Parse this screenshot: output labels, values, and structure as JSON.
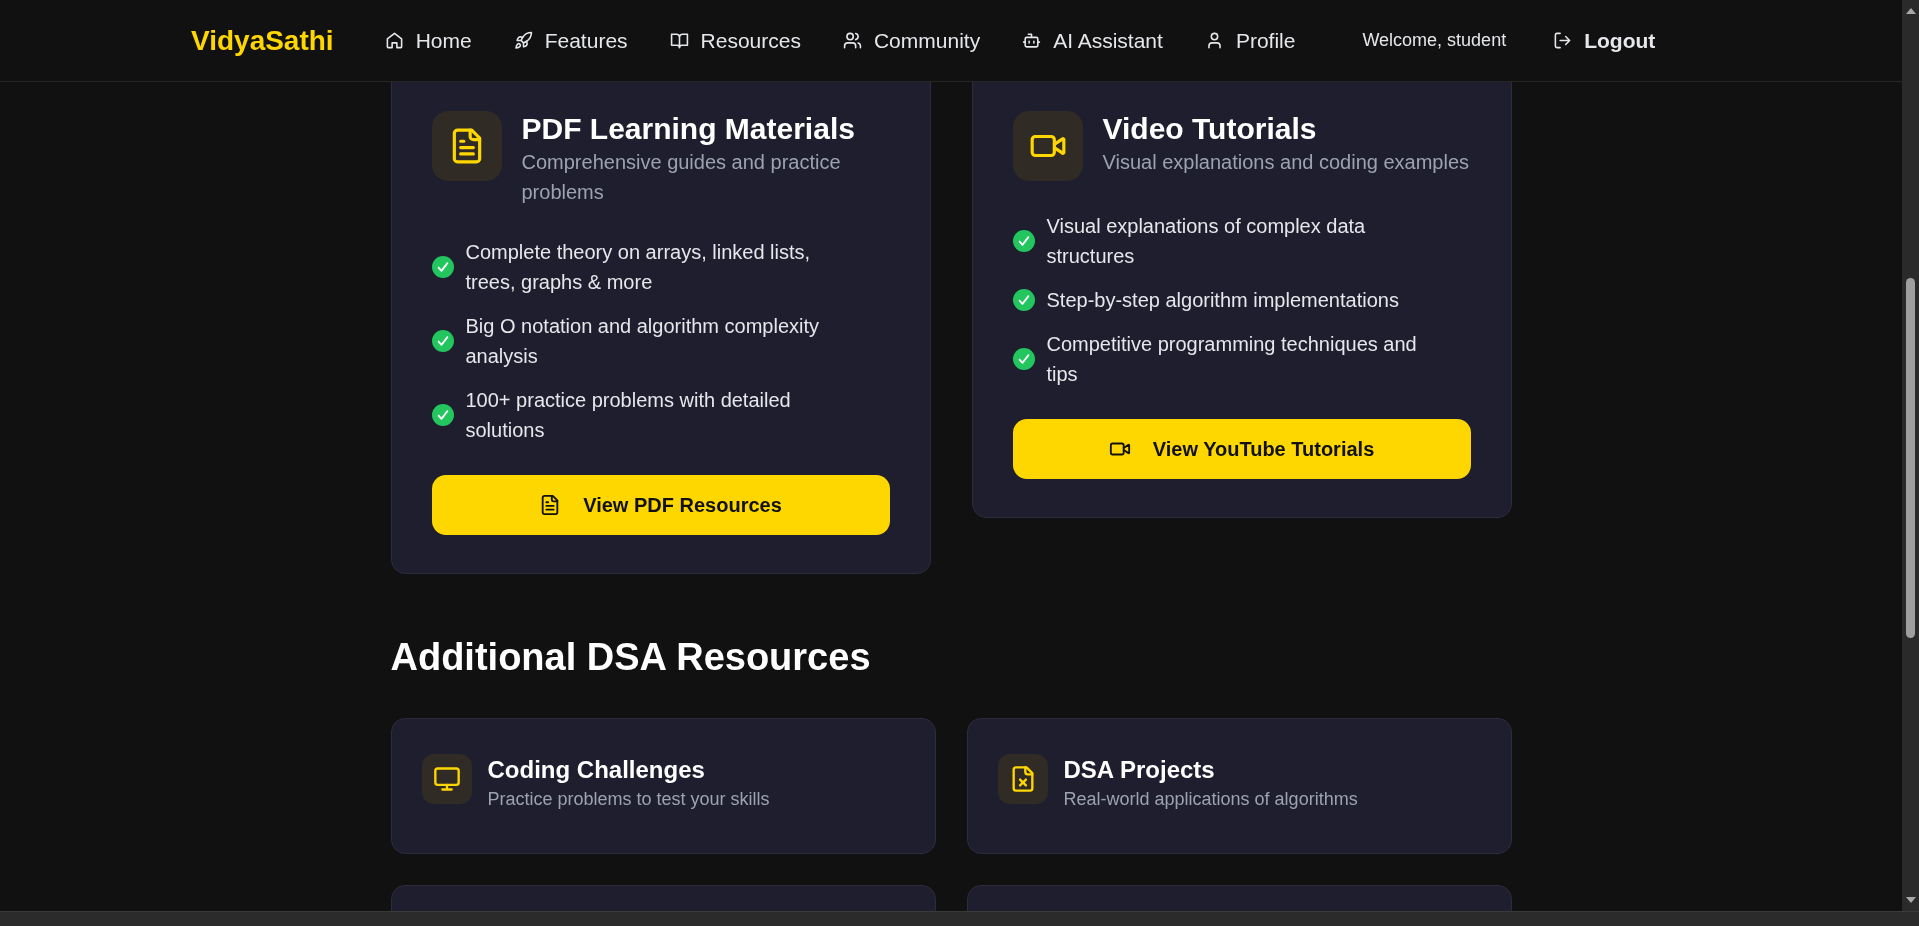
{
  "nav": {
    "logo": "VidyaSathi",
    "items": [
      {
        "label": "Home",
        "kind": "home"
      },
      {
        "label": "Features",
        "kind": "rocket"
      },
      {
        "label": "Resources",
        "kind": "book"
      },
      {
        "label": "Community",
        "kind": "users"
      },
      {
        "label": "AI Assistant",
        "kind": "bot"
      },
      {
        "label": "Profile",
        "kind": "user"
      }
    ],
    "welcome": "Welcome, student",
    "logout": "Logout"
  },
  "main_cards": [
    {
      "kind": "file",
      "title": "PDF Learning Materials",
      "subtitle": "Comprehensive guides and practice problems",
      "features": [
        "Complete theory on arrays, linked lists, trees, graphs & more",
        "Big O notation and algorithm complexity analysis",
        "100+ practice problems with detailed solutions"
      ],
      "button": {
        "label": "View PDF Resources",
        "kind": "file"
      }
    },
    {
      "kind": "video",
      "title": "Video Tutorials",
      "subtitle": "Visual explanations and coding examples",
      "features": [
        "Visual explanations of complex data structures",
        "Step-by-step algorithm implementations",
        "Competitive programming techniques and tips"
      ],
      "button": {
        "label": "View YouTube Tutorials",
        "kind": "video"
      }
    }
  ],
  "additional": {
    "heading": "Additional DSA Resources",
    "cards": [
      {
        "kind": "monitor",
        "title": "Coding Challenges",
        "subtitle": "Practice problems to test your skills"
      },
      {
        "kind": "file-x",
        "title": "DSA Projects",
        "subtitle": "Real-world applications of algorithms"
      }
    ]
  }
}
